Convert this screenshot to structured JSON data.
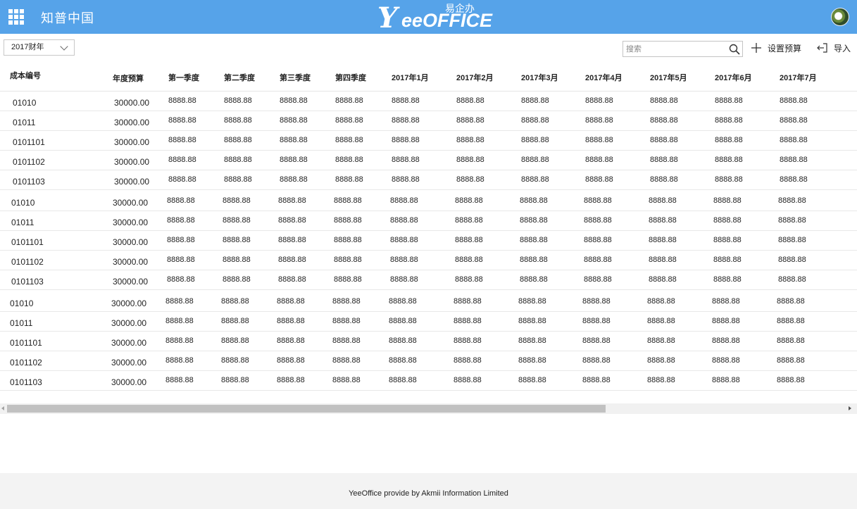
{
  "header": {
    "org_name": "知普中国",
    "brand_big": "Y",
    "brand_small": "eeOFFICE",
    "brand_cn": "易企办",
    "colors": {
      "bar": "#56a3e9",
      "text": "#ffffff"
    }
  },
  "toolbar": {
    "year_select": "2017财年",
    "search_placeholder": "搜索",
    "search_value": "",
    "set_budget_label": "设置预算",
    "import_label": "导入"
  },
  "table": {
    "columns": [
      "成本编号",
      "年度预算",
      "第一季度",
      "第二季度",
      "第三季度",
      "第四季度",
      "2017年1月",
      "2017年2月",
      "2017年3月",
      "2017年4月",
      "2017年5月",
      "2017年6月",
      "2017年7月"
    ],
    "rows": [
      [
        "01010",
        "30000.00",
        "8888.88",
        "8888.88",
        "8888.88",
        "8888.88",
        "8888.88",
        "8888.88",
        "8888.88",
        "8888.88",
        "8888.88",
        "8888.88",
        "8888.88"
      ],
      [
        "01011",
        "30000.00",
        "8888.88",
        "8888.88",
        "8888.88",
        "8888.88",
        "8888.88",
        "8888.88",
        "8888.88",
        "8888.88",
        "8888.88",
        "8888.88",
        "8888.88"
      ],
      [
        "0101101",
        "30000.00",
        "8888.88",
        "8888.88",
        "8888.88",
        "8888.88",
        "8888.88",
        "8888.88",
        "8888.88",
        "8888.88",
        "8888.88",
        "8888.88",
        "8888.88"
      ],
      [
        "0101102",
        "30000.00",
        "8888.88",
        "8888.88",
        "8888.88",
        "8888.88",
        "8888.88",
        "8888.88",
        "8888.88",
        "8888.88",
        "8888.88",
        "8888.88",
        "8888.88"
      ],
      [
        "0101103",
        "30000.00",
        "8888.88",
        "8888.88",
        "8888.88",
        "8888.88",
        "8888.88",
        "8888.88",
        "8888.88",
        "8888.88",
        "8888.88",
        "8888.88",
        "8888.88"
      ],
      [
        "01010",
        "30000.00",
        "8888.88",
        "8888.88",
        "8888.88",
        "8888.88",
        "8888.88",
        "8888.88",
        "8888.88",
        "8888.88",
        "8888.88",
        "8888.88",
        "8888.88"
      ],
      [
        "01011",
        "30000.00",
        "8888.88",
        "8888.88",
        "8888.88",
        "8888.88",
        "8888.88",
        "8888.88",
        "8888.88",
        "8888.88",
        "8888.88",
        "8888.88",
        "8888.88"
      ],
      [
        "0101101",
        "30000.00",
        "8888.88",
        "8888.88",
        "8888.88",
        "8888.88",
        "8888.88",
        "8888.88",
        "8888.88",
        "8888.88",
        "8888.88",
        "8888.88",
        "8888.88"
      ],
      [
        "0101102",
        "30000.00",
        "8888.88",
        "8888.88",
        "8888.88",
        "8888.88",
        "8888.88",
        "8888.88",
        "8888.88",
        "8888.88",
        "8888.88",
        "8888.88",
        "8888.88"
      ],
      [
        "0101103",
        "30000.00",
        "8888.88",
        "8888.88",
        "8888.88",
        "8888.88",
        "8888.88",
        "8888.88",
        "8888.88",
        "8888.88",
        "8888.88",
        "8888.88",
        "8888.88"
      ],
      [
        "01010",
        "30000.00",
        "8888.88",
        "8888.88",
        "8888.88",
        "8888.88",
        "8888.88",
        "8888.88",
        "8888.88",
        "8888.88",
        "8888.88",
        "8888.88",
        "8888.88"
      ],
      [
        "01011",
        "30000.00",
        "8888.88",
        "8888.88",
        "8888.88",
        "8888.88",
        "8888.88",
        "8888.88",
        "8888.88",
        "8888.88",
        "8888.88",
        "8888.88",
        "8888.88"
      ],
      [
        "0101101",
        "30000.00",
        "8888.88",
        "8888.88",
        "8888.88",
        "8888.88",
        "8888.88",
        "8888.88",
        "8888.88",
        "8888.88",
        "8888.88",
        "8888.88",
        "8888.88"
      ],
      [
        "0101102",
        "30000.00",
        "8888.88",
        "8888.88",
        "8888.88",
        "8888.88",
        "8888.88",
        "8888.88",
        "8888.88",
        "8888.88",
        "8888.88",
        "8888.88",
        "8888.88"
      ],
      [
        "0101103",
        "30000.00",
        "8888.88",
        "8888.88",
        "8888.88",
        "8888.88",
        "8888.88",
        "8888.88",
        "8888.88",
        "8888.88",
        "8888.88",
        "8888.88",
        "8888.88"
      ]
    ]
  },
  "scrollbar": {
    "horizontal_visible_fraction": 0.71
  },
  "footer": {
    "text": "YeeOffice provide by Akmii Information Limited"
  }
}
